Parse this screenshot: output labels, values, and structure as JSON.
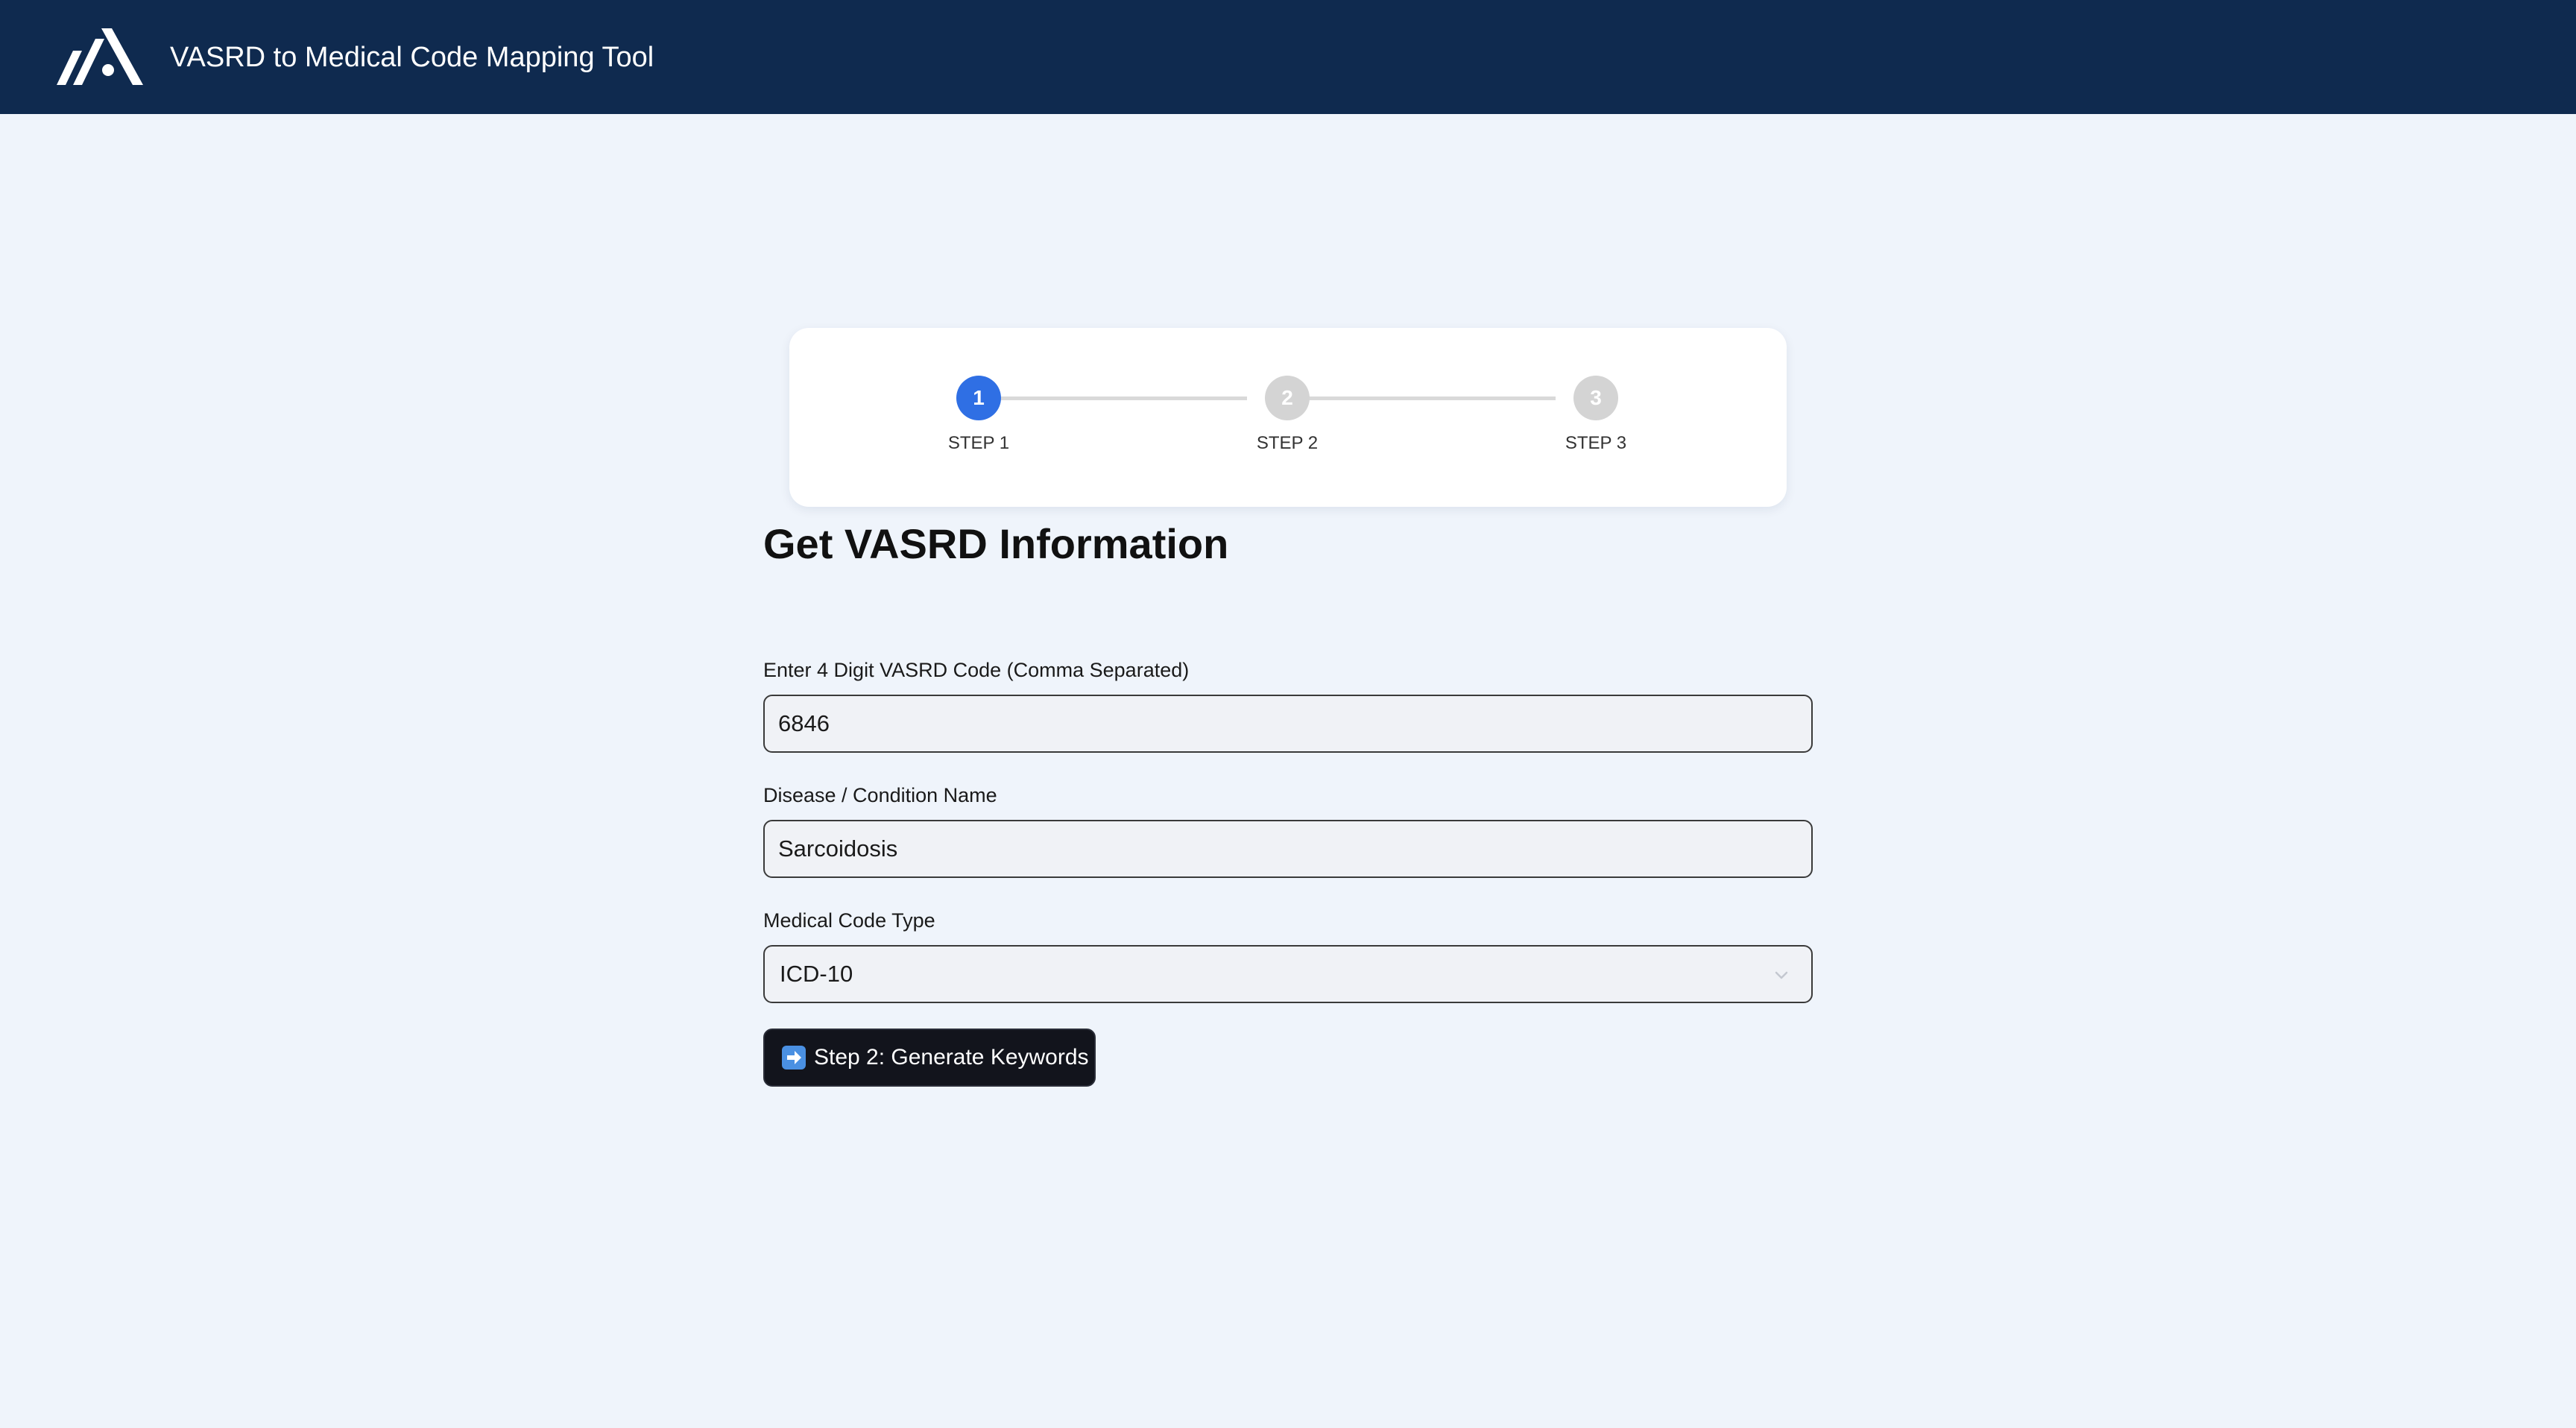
{
  "header": {
    "title": "VASRD to Medical Code Mapping Tool",
    "logo_icon": "mountain-logo-icon",
    "background_color": "#0f2a4f"
  },
  "stepper": {
    "steps": [
      {
        "number": "1",
        "label": "STEP 1",
        "active": true
      },
      {
        "number": "2",
        "label": "STEP 2",
        "active": false
      },
      {
        "number": "3",
        "label": "STEP 3",
        "active": false
      }
    ],
    "active_color": "#2f6fe4",
    "inactive_color": "#d4d4d4"
  },
  "form": {
    "title": "Get VASRD Information",
    "vasrd_code": {
      "label": "Enter 4 Digit VASRD Code (Comma Separated)",
      "value": "6846"
    },
    "condition_name": {
      "label": "Disease / Condition Name",
      "value": "Sarcoidosis"
    },
    "code_type": {
      "label": "Medical Code Type",
      "selected": "ICD-10"
    },
    "submit": {
      "label": "Step 2: Generate Keywords",
      "icon": "right-arrow-icon"
    }
  }
}
